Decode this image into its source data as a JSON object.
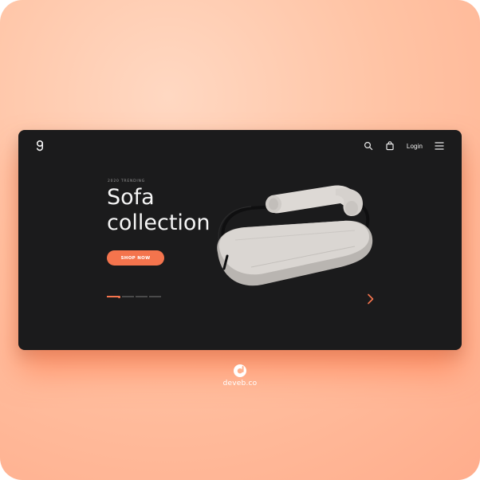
{
  "nav": {
    "logo": "g",
    "login_label": "Login",
    "icons": [
      "search-icon",
      "shopping-bag-icon",
      "menu-icon"
    ]
  },
  "hero": {
    "kicker": "2020 TRENDING",
    "title_line1": "Sofa",
    "title_line2": "collection",
    "cta_label": "SHOP NOW",
    "slides_total": 4,
    "slide_active": 1
  },
  "footer": {
    "brand_name": "deveb.co"
  },
  "colors": {
    "accent": "#f4744d",
    "screen_bg": "#1b1b1c",
    "background": "#ffc3a4"
  }
}
